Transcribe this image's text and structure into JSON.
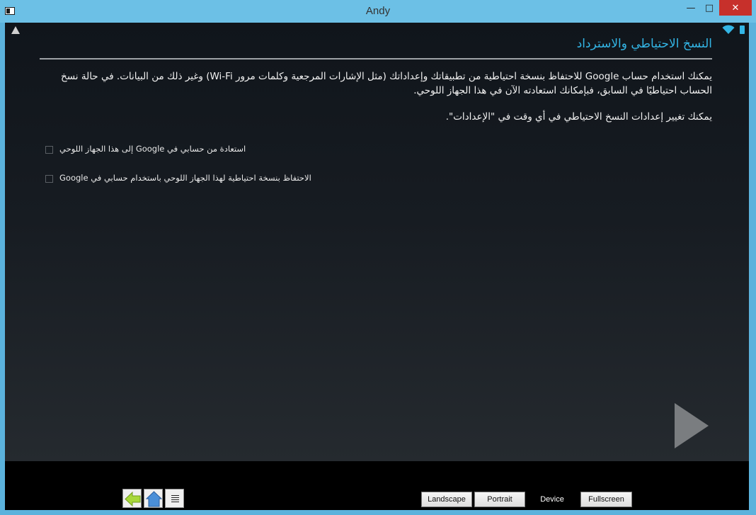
{
  "window": {
    "title": "Andy",
    "minimize_glyph": "—",
    "maximize_glyph": "□",
    "close_glyph": "✕"
  },
  "status_bar": {
    "left_icon": "warning-icon",
    "right_icons": [
      "wifi-icon",
      "battery-icon"
    ],
    "accent_color": "#33b5e5"
  },
  "page": {
    "title": "النسخ الاحتياطي والاسترداد",
    "paragraph1": "يمكنك استخدام حساب Google للاحتفاظ بنسخة احتياطية من تطبيقاتك وإعداداتك (مثل الإشارات المرجعية وكلمات مرور Wi-Fi) وغير ذلك من البيانات. في حالة نسخ الحساب احتياطيًا في السابق، فبإمكانك استعادته الآن في هذا الجهاز اللوحي.",
    "paragraph2": "يمكنك تغيير إعدادات النسخ الاحتياطي في أي وقت في \"الإعدادات\".",
    "options": [
      {
        "label": "استعادة من حسابي في Google إلى هذا الجهاز اللوحي",
        "checked": false
      },
      {
        "label": "الاحتفاظ بنسخة احتياطية لهذا الجهاز اللوحي باستخدام حسابي في Google",
        "checked": false
      }
    ],
    "next_icon": "next-arrow-icon"
  },
  "bottom_bar": {
    "nav_icons": [
      "back-arrow-icon",
      "home-icon",
      "menu-icon"
    ],
    "modes": {
      "landscape": "Landscape",
      "portrait": "Portrait",
      "device": "Device",
      "fullscreen": "Fullscreen"
    }
  }
}
